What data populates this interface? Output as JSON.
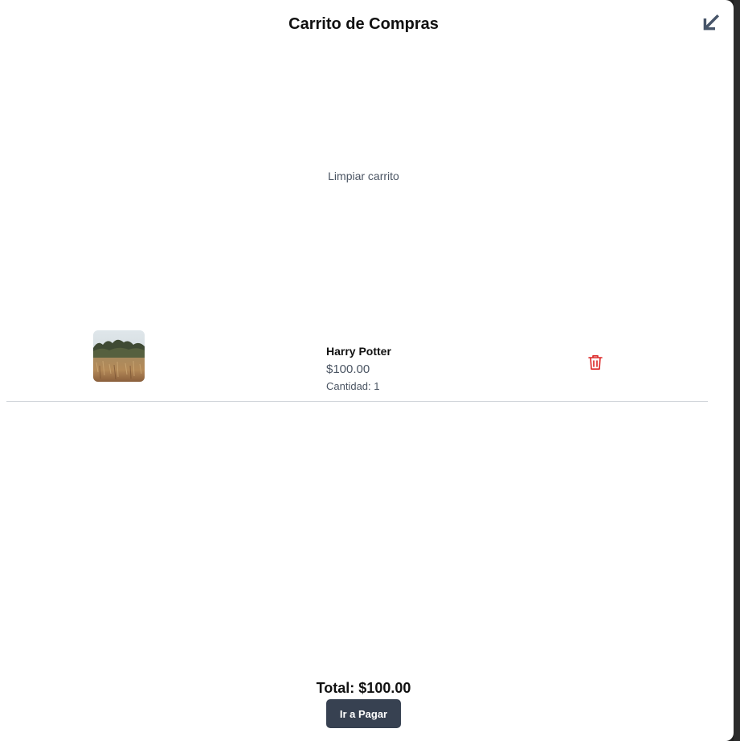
{
  "cart": {
    "title": "Carrito de Compras",
    "clear_label": "Limpiar carrito",
    "collapse_icon": "arrow-down-left-icon",
    "items": [
      {
        "name": "Harry Potter",
        "price": "$100.00",
        "quantity_label": "Cantidad:",
        "quantity": "1",
        "thumbnail_icon": "field-landscape-thumbnail",
        "delete_icon": "trash-icon"
      }
    ],
    "total_label": "Total:",
    "total_value": "$100.00",
    "pay_label": "Ir a Pagar"
  },
  "colors": {
    "accent_dark": "#374151",
    "delete_red": "#dc2626",
    "text_muted": "#4b5563"
  }
}
